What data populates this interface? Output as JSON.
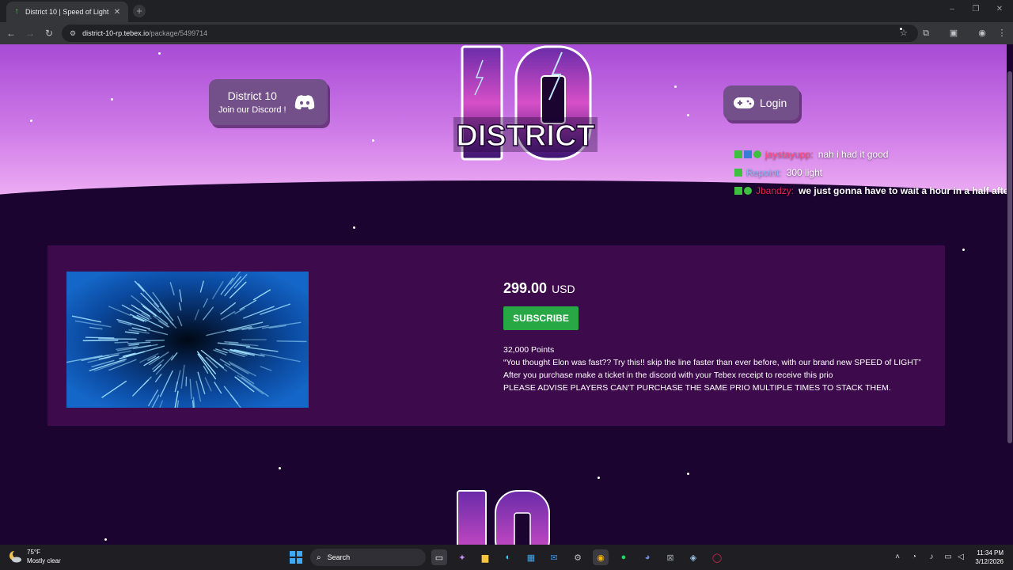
{
  "browser": {
    "tab_title": "District 10 | Speed of Light",
    "url_host": "district-10-rp.tebex.io",
    "url_path": "/package/5499714"
  },
  "header": {
    "discord_title": "District 10",
    "discord_subtitle": "Join our Discord !",
    "login_label": "Login",
    "logo_text": "DISTRICT"
  },
  "chat": [
    {
      "user": "jaystayupp:",
      "message": "nah i had it good",
      "color": "#ff4b7a"
    },
    {
      "user": "Repoint:",
      "message": "300 light",
      "color": "#8ab4f8"
    },
    {
      "user": "Jbandzy:",
      "message": "we just gonna have to wait a hour in a half afte",
      "color": "#e0244a"
    }
  ],
  "product": {
    "price": "299.00",
    "currency": "USD",
    "subscribe_label": "SUBSCRIBE",
    "points": "32,000 Points",
    "desc_line1": "“You thought Elon was fast?? Try this!! skip the line faster than ever before, with our brand new SPEED of LIGHT”",
    "desc_line2": "After you purchase make a ticket in the discord with your Tebex receipt to receive this prio",
    "desc_line3": "PLEASE ADVISE PLAYERS CAN'T PURCHASE THE SAME PRIO MULTIPLE TIMES TO STACK THEM."
  },
  "taskbar": {
    "temperature": "75°F",
    "condition": "Mostly clear",
    "search_label": "Search",
    "time": "11:34 PM",
    "date": "3/12/2026"
  },
  "colors": {
    "accent_green": "#28a745",
    "page_bg": "#1b0430",
    "card_bg": "#3d0a4b"
  }
}
